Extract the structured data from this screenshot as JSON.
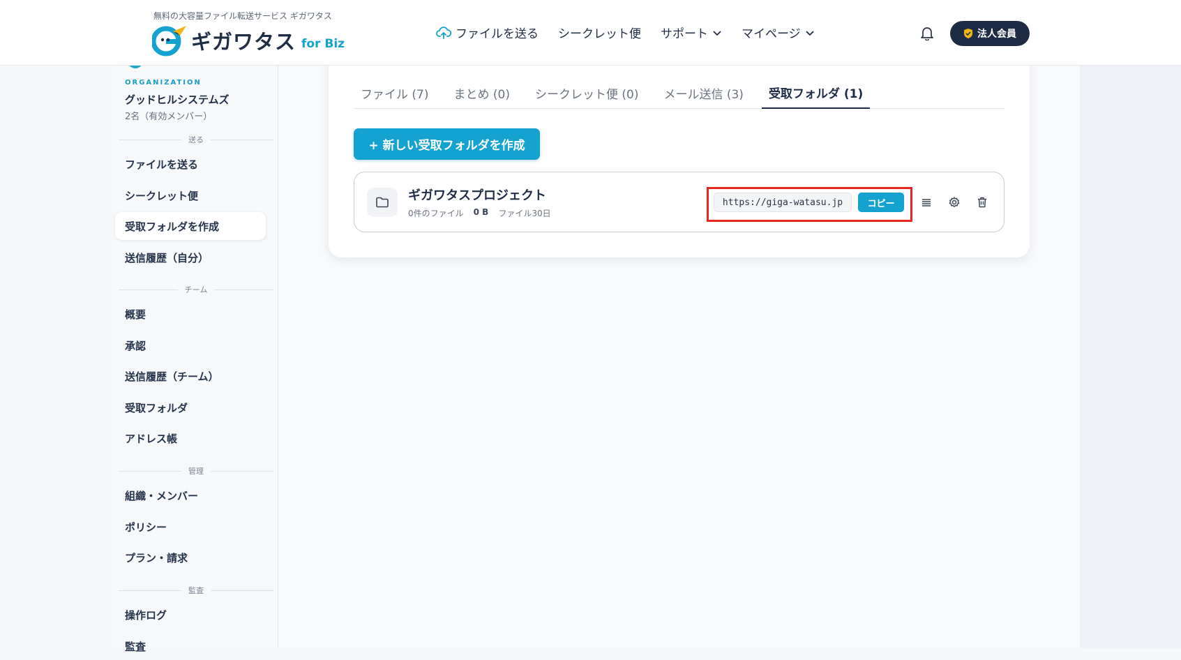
{
  "header": {
    "tagline": "無料の大容量ファイル転送サービス ギガワタス",
    "logo_text": "ギガワタス",
    "logo_sub": "for Biz",
    "nav": [
      {
        "label": "ファイルを送る",
        "icon": "cloud-upload-icon"
      },
      {
        "label": "シークレット便"
      },
      {
        "label": "サポート",
        "icon": "chevron-down-icon"
      },
      {
        "label": "マイページ",
        "icon": "chevron-down-icon"
      }
    ],
    "member_badge": "法人会員",
    "colors": {
      "brand": "#14a3d0",
      "navy": "#1d2b45"
    }
  },
  "sidebar": {
    "org_label": "ORGANIZATION",
    "org_name": "グッドヒルシステムズ",
    "org_count": "2名（有効メンバー）",
    "sections": {
      "send": "送る",
      "team": "チーム",
      "admin": "管理",
      "audit": "監査"
    },
    "items": [
      {
        "label": "ファイルを送る"
      },
      {
        "label": "シークレット便"
      },
      {
        "label": "受取フォルダを作成",
        "active": true
      },
      {
        "label": "送信履歴（自分）"
      },
      {
        "label": "概要"
      },
      {
        "label": "承認"
      },
      {
        "label": "送信履歴（チーム）"
      },
      {
        "label": "受取フォルダ"
      },
      {
        "label": "アドレス帳"
      },
      {
        "label": "組織・メンバー"
      },
      {
        "label": "ポリシー"
      },
      {
        "label": "プラン・請求"
      },
      {
        "label": "操作ログ"
      },
      {
        "label": "監査"
      }
    ]
  },
  "main": {
    "tabs": [
      {
        "label": "ファイル (7)"
      },
      {
        "label": "まとめ (0)"
      },
      {
        "label": "シークレット便 (0)"
      },
      {
        "label": "メール送信 (3)"
      },
      {
        "label": "受取フォルダ (1)",
        "active": true
      }
    ],
    "create_button": "+ 新しい受取フォルダを作成",
    "folder": {
      "name": "ギガワタスプロジェクト",
      "file_count": "0件のファイル",
      "size": "0 B",
      "retention": "ファイル30日",
      "url": "https://giga-watasu.jp",
      "copy_label": "コピー",
      "highlight_color": "#e5271f"
    }
  }
}
